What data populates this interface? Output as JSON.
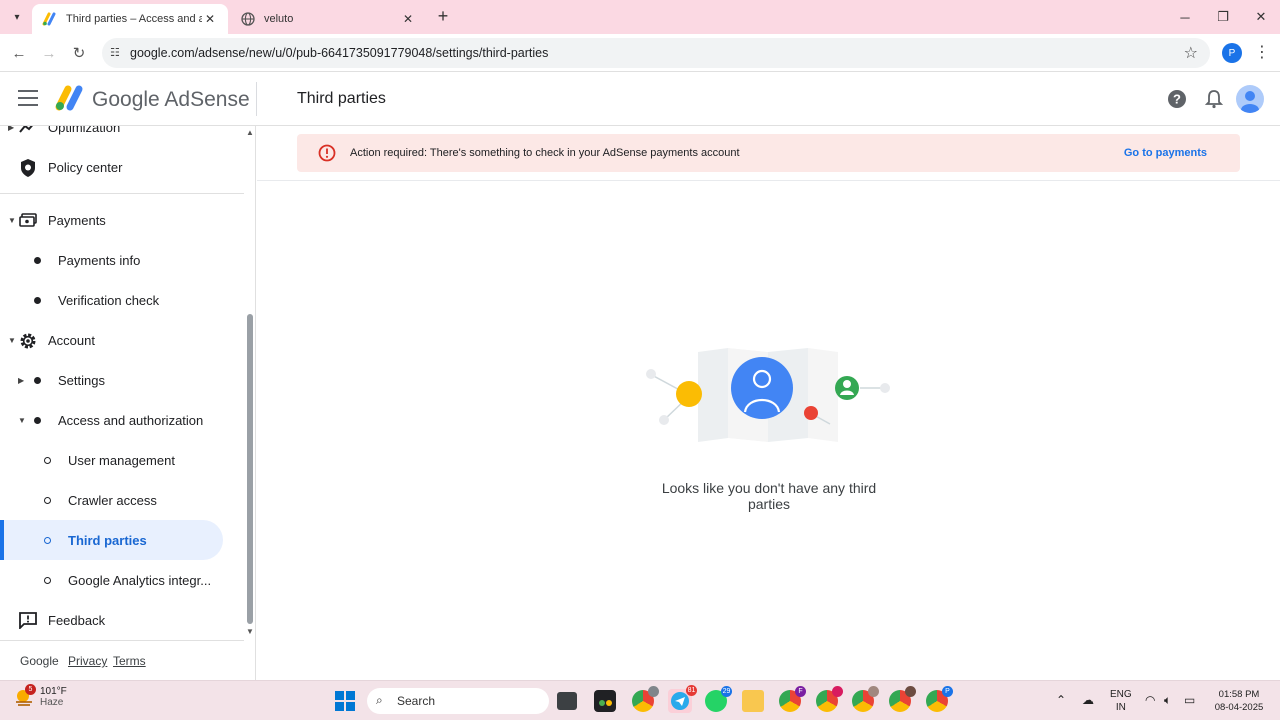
{
  "browser": {
    "tabs": [
      {
        "title": "Third parties – Access and auth",
        "active": true
      },
      {
        "title": "veluto",
        "active": false
      }
    ],
    "url": "google.com/adsense/new/u/0/pub-6641735091779048/settings/third-parties",
    "profile_initial": "P"
  },
  "header": {
    "brand": "Google AdSense",
    "page_title": "Third parties"
  },
  "sidebar": {
    "items": [
      {
        "label": "Optimization"
      },
      {
        "label": "Policy center"
      },
      {
        "label": "Payments"
      },
      {
        "label": "Payments info"
      },
      {
        "label": "Verification check"
      },
      {
        "label": "Account"
      },
      {
        "label": "Settings"
      },
      {
        "label": "Access and authorization"
      },
      {
        "label": "User management"
      },
      {
        "label": "Crawler access"
      },
      {
        "label": "Third parties"
      },
      {
        "label": "Google Analytics integr..."
      },
      {
        "label": "Feedback"
      }
    ],
    "footer": {
      "google": "Google",
      "privacy": "Privacy",
      "terms": "Terms"
    }
  },
  "alert": {
    "text": "Action required: There's something to check in your AdSense payments account",
    "link": "Go to payments"
  },
  "empty_state": {
    "text": "Looks like you don't have any third parties"
  },
  "taskbar": {
    "weather_temp": "101°F",
    "weather_desc": "Haze",
    "weather_badge": "5",
    "search_placeholder": "Search",
    "badges": {
      "telegram": "81",
      "whatsapp": "29",
      "chrome_f": "F",
      "chrome_p": "P"
    },
    "lang": "ENG",
    "region": "IN",
    "time": "01:58 PM",
    "date": "08-04-2025"
  },
  "colors": {
    "accent": "#1a73e8",
    "alert_bg": "#fce8e6",
    "alert_icon": "#d93025",
    "selected_bg": "#e8f0fe",
    "tabstrip": "#fbd9e3"
  }
}
